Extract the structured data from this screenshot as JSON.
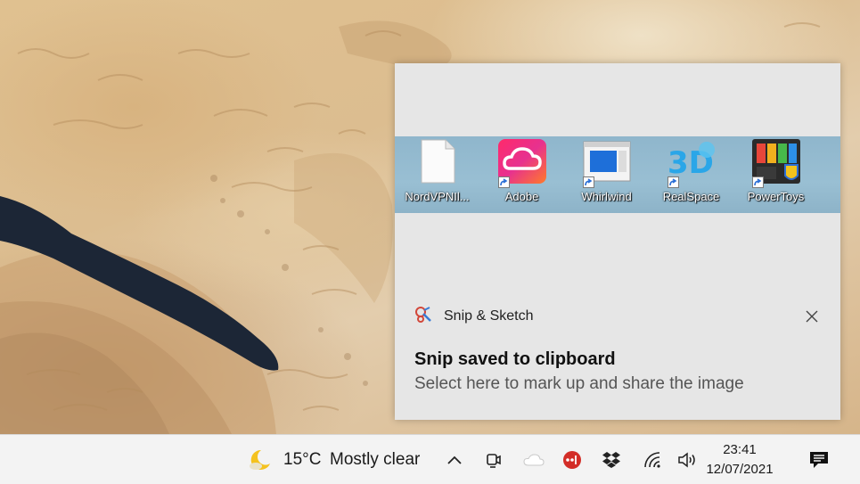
{
  "desktop_icons": [
    {
      "label": "NordVPNIl...",
      "icon": "file-icon"
    },
    {
      "label": "Adobe",
      "icon": "adobe-creative-cloud-icon"
    },
    {
      "label": "Whirlwind",
      "icon": "window-app-icon"
    },
    {
      "label": "RealSpace",
      "icon": "realspace-3d-icon"
    },
    {
      "label": "PowerToys",
      "icon": "powertoys-icon"
    }
  ],
  "notification": {
    "app_name": "Snip & Sketch",
    "title": "Snip saved to clipboard",
    "body": "Select here to mark up and share the image"
  },
  "taskbar": {
    "weather": {
      "temperature": "15°C",
      "condition": "Mostly clear",
      "icon": "moon-cloud-icon"
    },
    "tray_icons": [
      "chevron-up-icon",
      "meet-now-icon",
      "onedrive-cloud-icon",
      "lastpass-icon",
      "dropbox-icon",
      "wifi-icon",
      "volume-icon"
    ],
    "clock": {
      "time": "23:41",
      "date": "12/07/2021"
    },
    "notification_center_icon": "action-center-icon"
  },
  "colors": {
    "taskbar": "#f3f3f3",
    "toast": "#e6e6e6",
    "toast_title": "#111111",
    "toast_body": "#555555"
  }
}
